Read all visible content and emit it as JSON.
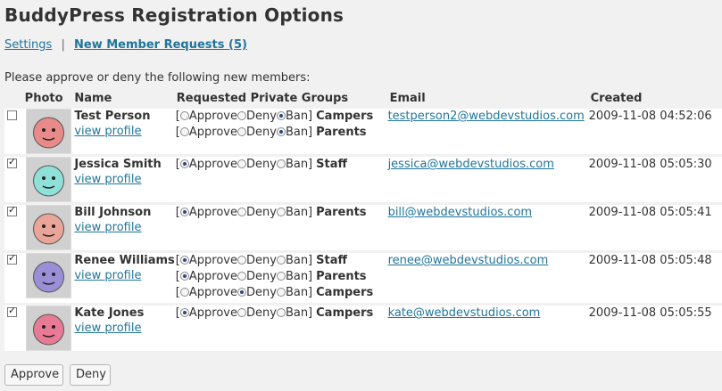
{
  "page": {
    "title": "BuddyPress Registration Options",
    "nav": {
      "settings": "Settings",
      "separator": "|",
      "requests": "New Member Requests (5)"
    },
    "intro": "Please approve or deny the following new members:"
  },
  "table": {
    "headers": {
      "photo": "Photo",
      "name": "Name",
      "groups": "Requested Private Groups",
      "email": "Email",
      "created": "Created"
    }
  },
  "labels": {
    "approve": "Approve",
    "deny": "Deny",
    "ban": "Ban]",
    "open": "[",
    "view_profile": "view profile"
  },
  "members": [
    {
      "checked": false,
      "name": "Test Person",
      "avatar_color": "#e88a8a",
      "email": "testperson2@webdevstudios.com",
      "created": "2009-11-08 04:52:06",
      "groups": [
        {
          "name": "Campers",
          "choice": "Ban"
        },
        {
          "name": "Parents",
          "choice": "Ban"
        }
      ]
    },
    {
      "checked": true,
      "name": "Jessica Smith",
      "avatar_color": "#8fe0d8",
      "email": "jessica@webdevstudios.com",
      "created": "2009-11-08 05:05:30",
      "groups": [
        {
          "name": "Staff",
          "choice": "Approve"
        }
      ]
    },
    {
      "checked": true,
      "name": "Bill Johnson",
      "avatar_color": "#e9a59a",
      "email": "bill@webdevstudios.com",
      "created": "2009-11-08 05:05:41",
      "groups": [
        {
          "name": "Parents",
          "choice": "Approve"
        }
      ]
    },
    {
      "checked": true,
      "name": "Renee Williams",
      "avatar_color": "#9a8fd6",
      "email": "renee@webdevstudios.com",
      "created": "2009-11-08 05:05:48",
      "groups": [
        {
          "name": "Staff",
          "choice": "Approve"
        },
        {
          "name": "Parents",
          "choice": "Approve"
        },
        {
          "name": "Campers",
          "choice": "Deny"
        }
      ]
    },
    {
      "checked": true,
      "name": "Kate Jones",
      "avatar_color": "#e87a96",
      "email": "kate@webdevstudios.com",
      "created": "2009-11-08 05:05:55",
      "groups": [
        {
          "name": "Campers",
          "choice": "Approve"
        }
      ]
    }
  ],
  "buttons": {
    "approve": "Approve",
    "deny": "Deny"
  },
  "colors": {
    "link": "#21759b",
    "background": "#f1f1f1",
    "row": "#ffffff"
  }
}
